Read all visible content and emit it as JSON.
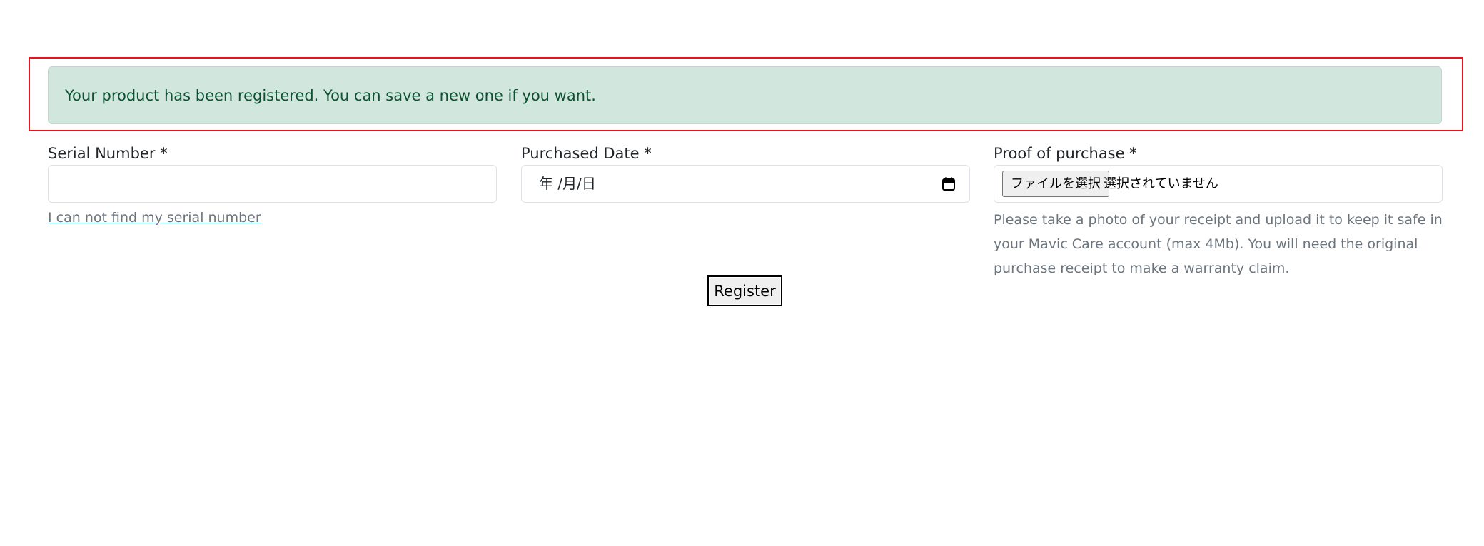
{
  "alert": {
    "message": "Your product has been registered. You can save a new one if you want."
  },
  "form": {
    "serial": {
      "label": "Serial Number *",
      "value": "",
      "help_link": "I can not find my serial number"
    },
    "purchased_date": {
      "label": "Purchased Date *",
      "placeholder": "年 /月/日",
      "icon": "calendar-icon"
    },
    "proof": {
      "label": "Proof of purchase *",
      "button_label": "ファイルを選択",
      "status": "選択されていません",
      "help_text": "Please take a photo of your receipt and upload it to keep it safe in your Mavic Care account (max 4Mb). You will need the original purchase receipt to make a warranty claim."
    },
    "submit_label": "Register"
  },
  "colors": {
    "alert_bg": "#d1e7dd",
    "alert_text": "#0f5132",
    "highlight_border": "#e8141e",
    "muted_text": "#6c757d",
    "link_underline": "#0d6efd"
  }
}
